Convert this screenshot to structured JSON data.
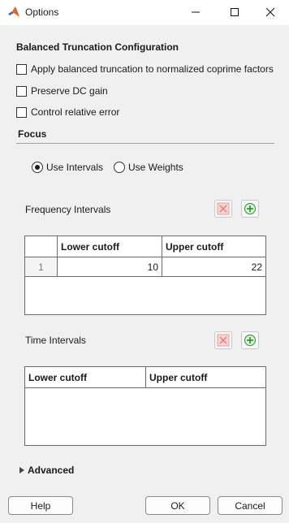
{
  "window": {
    "title": "Options"
  },
  "config": {
    "title": "Balanced Truncation Configuration",
    "options": [
      {
        "label": "Apply balanced truncation to normalized coprime factors",
        "checked": false
      },
      {
        "label": "Preserve DC gain",
        "checked": false
      },
      {
        "label": "Control relative error",
        "checked": false
      }
    ]
  },
  "focus": {
    "title": "Focus",
    "radio_intervals": "Use Intervals",
    "radio_weights": "Use Weights",
    "selected": "Use Intervals"
  },
  "frequency": {
    "label": "Frequency Intervals",
    "columns": [
      "",
      "Lower cutoff",
      "Upper cutoff"
    ],
    "rows": [
      {
        "index": "1",
        "lower": "10",
        "upper": "22"
      }
    ]
  },
  "time": {
    "label": "Time Intervals",
    "columns": [
      "Lower cutoff",
      "Upper cutoff"
    ],
    "rows": []
  },
  "advanced": {
    "label": "Advanced"
  },
  "buttons": {
    "help": "Help",
    "ok": "OK",
    "cancel": "Cancel"
  },
  "icons": {
    "app": "matlab-logo-icon",
    "delete": "delete-row-icon",
    "add": "add-row-icon",
    "expand": "triangle-right-icon"
  }
}
